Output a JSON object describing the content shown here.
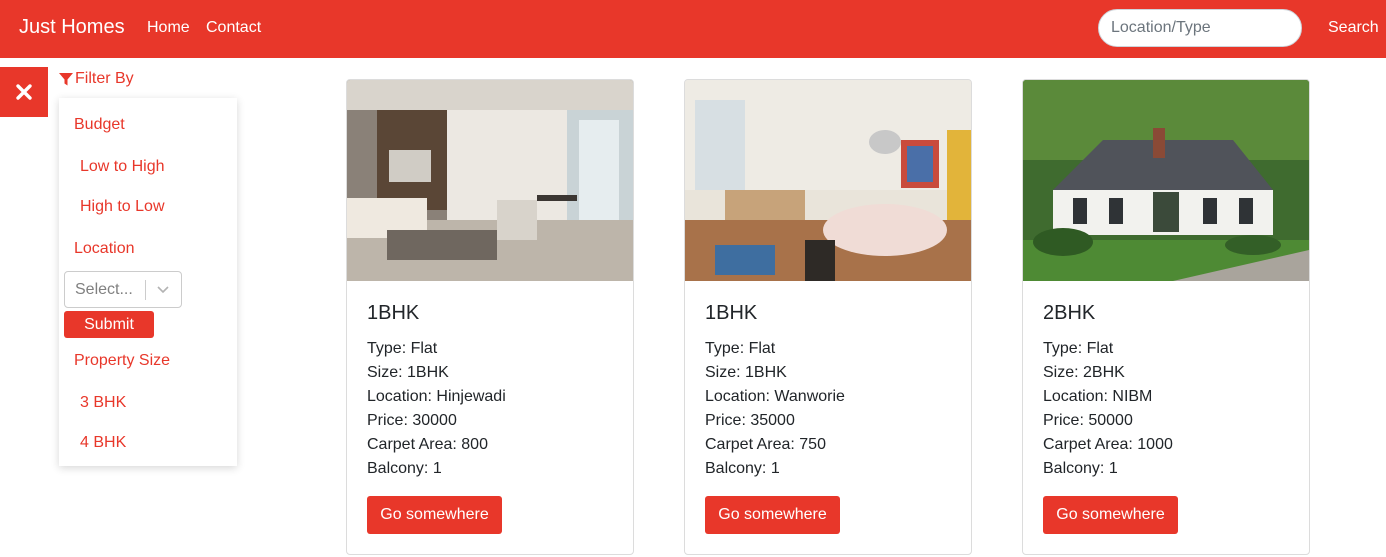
{
  "navbar": {
    "brand": "Just Homes",
    "links": [
      "Home",
      "Contact"
    ],
    "search_placeholder": "Location/Type",
    "search_button": "Search"
  },
  "sidebar": {
    "close_icon": "close-icon",
    "filter_title": "Filter By",
    "filter_icon": "funnel-icon",
    "budget_label": "Budget",
    "budget_options": [
      "Low to High",
      "High to Low"
    ],
    "location_label": "Location",
    "location_select_placeholder": "Select...",
    "submit_label": "Submit",
    "size_label": "Property Size",
    "size_options": [
      "3 BHK",
      "4 BHK"
    ]
  },
  "colors": {
    "accent": "#e8372a",
    "text": "#212529"
  },
  "cards": [
    {
      "title": "1BHK",
      "image": "modern living room interior",
      "lines": [
        "Type: Flat",
        "Size: 1BHK",
        "Location: Hinjewadi",
        "Price: 30000",
        "Carpet Area: 800",
        "Balcony: 1"
      ],
      "button": "Go somewhere"
    },
    {
      "title": "1BHK",
      "image": "bright dining room interior",
      "lines": [
        "Type: Flat",
        "Size: 1BHK",
        "Location: Wanworie",
        "Price: 35000",
        "Carpet Area: 750",
        "Balcony: 1"
      ],
      "button": "Go somewhere"
    },
    {
      "title": "2BHK",
      "image": "white cottage house exterior",
      "lines": [
        "Type: Flat",
        "Size: 2BHK",
        "Location: NIBM",
        "Price: 50000",
        "Carpet Area: 1000",
        "Balcony: 1"
      ],
      "button": "Go somewhere"
    }
  ]
}
